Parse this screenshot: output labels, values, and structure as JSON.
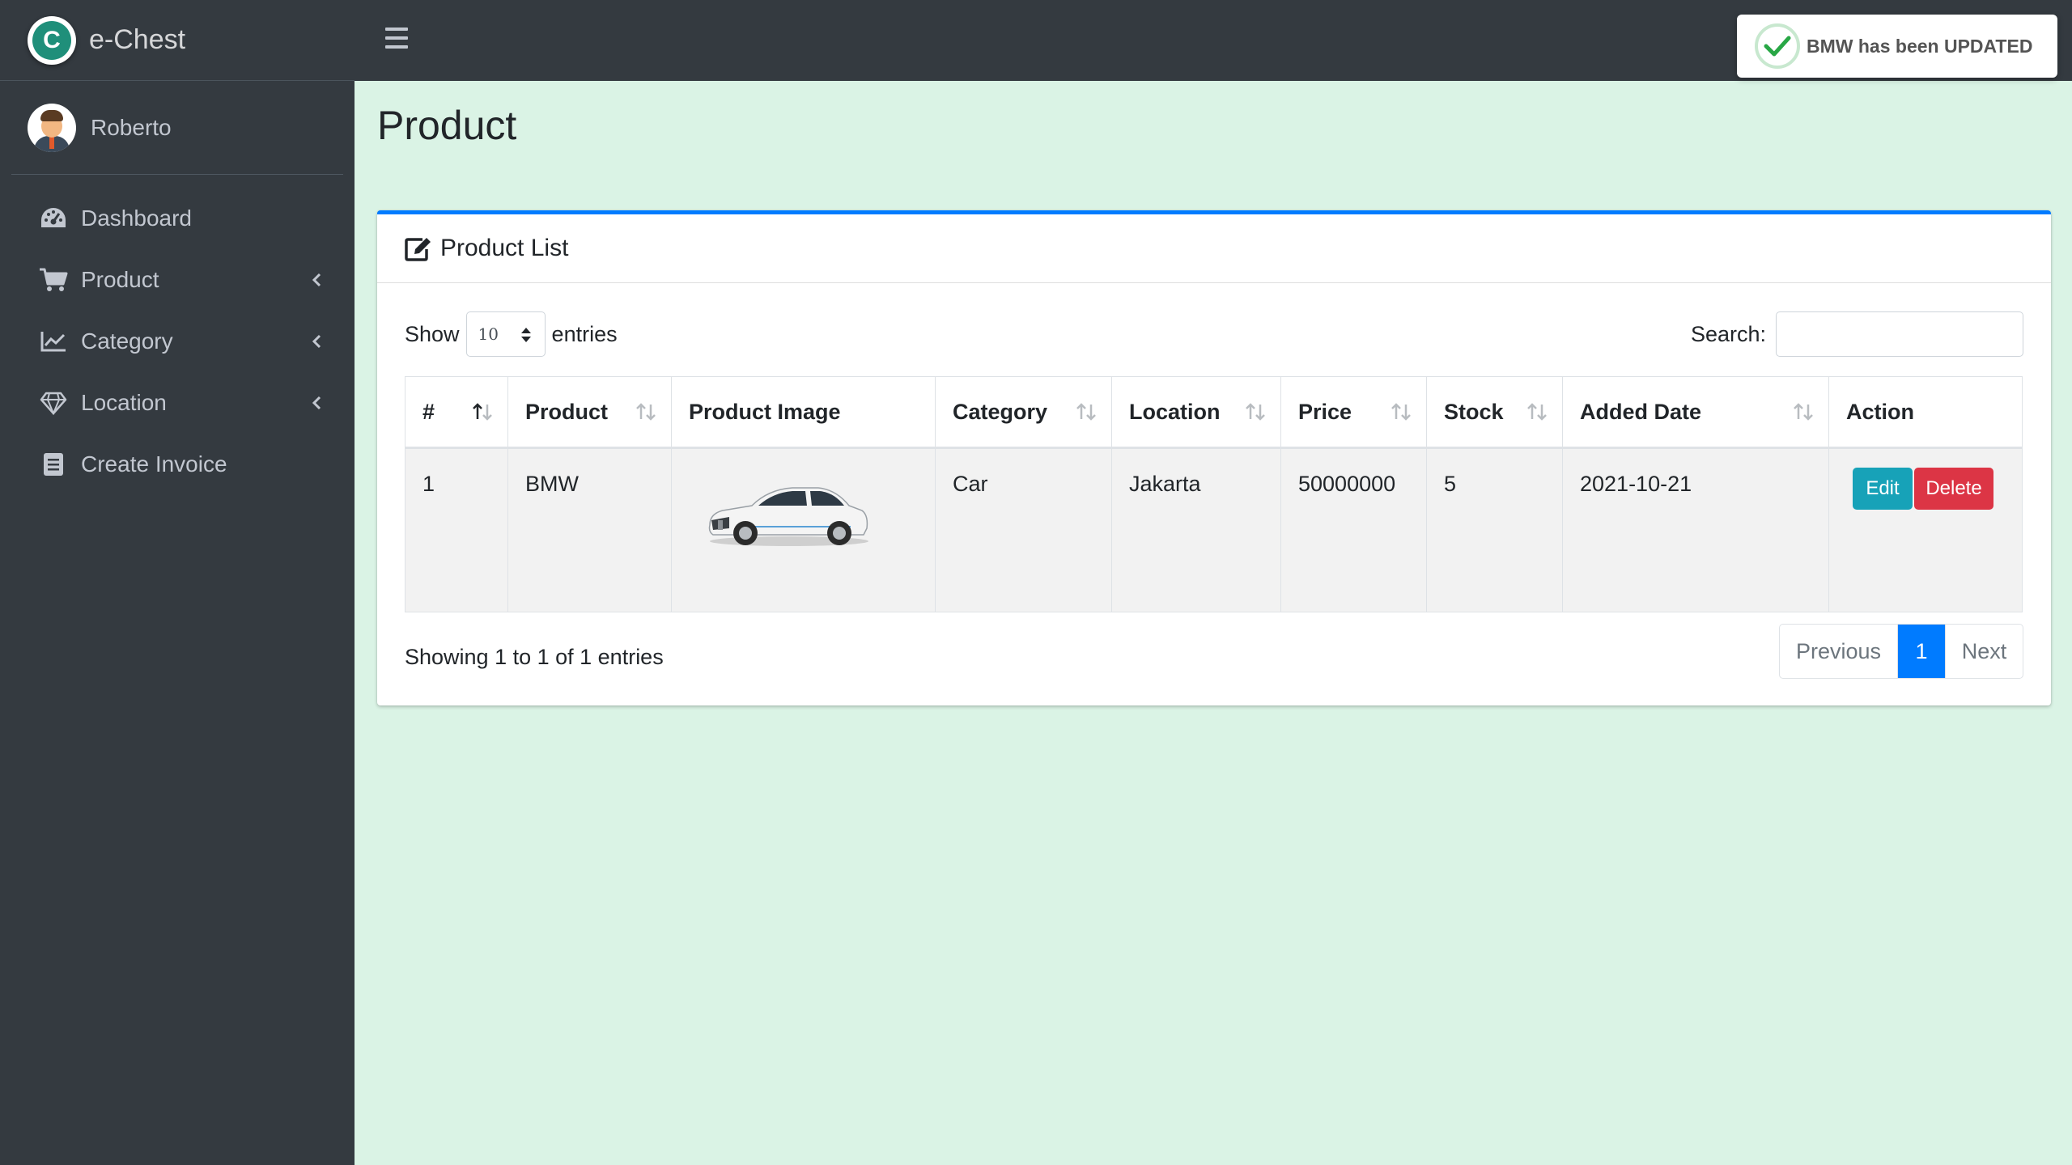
{
  "brand": {
    "name": "e-Chest",
    "logo_letter": "C"
  },
  "user": {
    "name": "Roberto"
  },
  "sidebar": {
    "items": [
      {
        "label": "Dashboard",
        "icon": "tachometer-icon"
      },
      {
        "label": "Product",
        "icon": "cart-icon",
        "has_children": true
      },
      {
        "label": "Category",
        "icon": "chart-line-icon",
        "has_children": true
      },
      {
        "label": "Location",
        "icon": "gem-icon",
        "has_children": true
      },
      {
        "label": "Create Invoice",
        "icon": "invoice-icon"
      }
    ]
  },
  "toast": {
    "message": "BMW has been UPDATED",
    "type": "success",
    "color": "#28a745"
  },
  "page": {
    "title": "Product"
  },
  "card": {
    "title": "Product List",
    "accent": "#007bff"
  },
  "controls": {
    "show_label": "Show",
    "entries_value": "10",
    "entries_label": "entries",
    "search_label": "Search:",
    "search_value": ""
  },
  "table": {
    "headers": [
      "#",
      "Product",
      "Product Image",
      "Category",
      "Location",
      "Price",
      "Stock",
      "Added Date",
      "Action"
    ],
    "rows": [
      {
        "no": "1",
        "product": "BMW",
        "image": "white BMW sedan",
        "category": "Car",
        "location": "Jakarta",
        "price": "50000000",
        "stock": "5",
        "added_date": "2021-10-21",
        "edit_label": "Edit",
        "delete_label": "Delete"
      }
    ]
  },
  "footer": {
    "info": "Showing 1 to 1 of 1 entries",
    "prev_label": "Previous",
    "current_page": "1",
    "next_label": "Next"
  },
  "colors": {
    "sidebar_bg": "#343a40",
    "content_bg": "#daf3e5",
    "primary": "#007bff",
    "edit": "#17a2b8",
    "delete": "#dc3545"
  }
}
